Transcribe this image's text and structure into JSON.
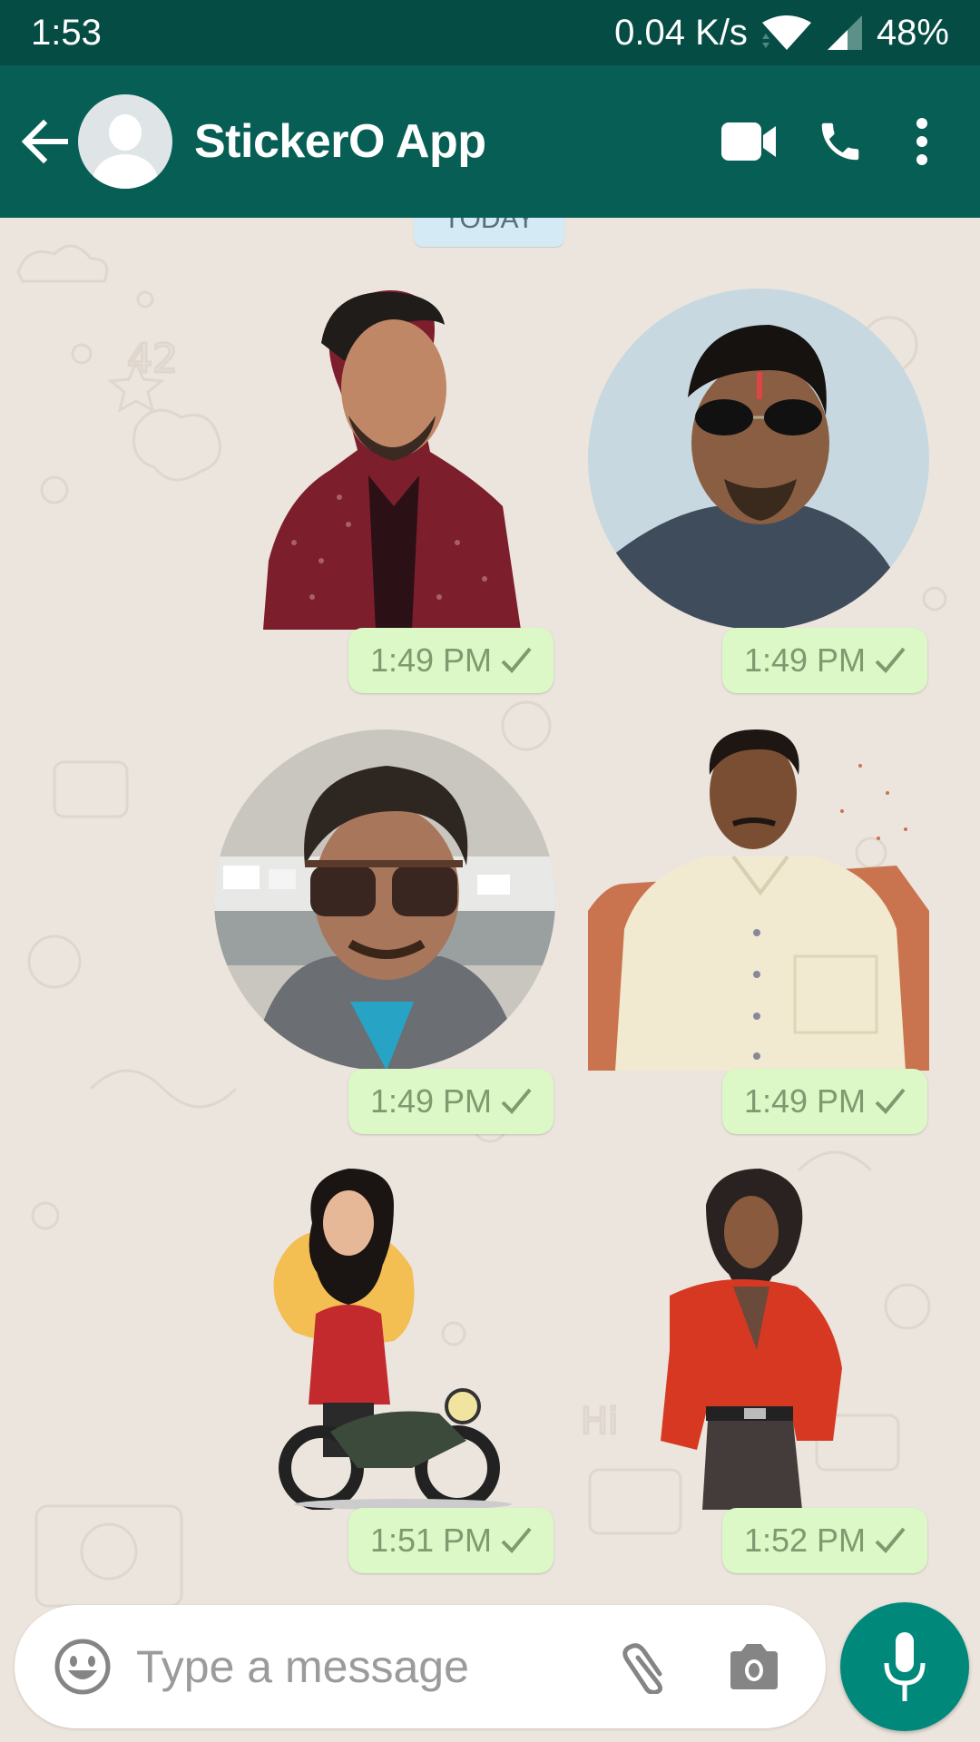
{
  "status_bar": {
    "time": "1:53",
    "network_speed": "0.04 K/s",
    "battery": "48%",
    "icons": [
      "wifi-icon",
      "cell-signal-icon"
    ]
  },
  "header": {
    "title": "StickerO App",
    "icons": [
      "back-arrow-icon",
      "avatar-icon",
      "video-call-icon",
      "voice-call-icon",
      "more-vert-icon"
    ]
  },
  "chat": {
    "date_label": "TODAY",
    "messages": [
      {
        "type": "sticker",
        "subject": "man in maroon shirt",
        "shape": "cutout",
        "time": "1:49 PM",
        "status": "sent"
      },
      {
        "type": "sticker",
        "subject": "man with aviator sunglasses",
        "shape": "circle",
        "time": "1:49 PM",
        "status": "sent"
      },
      {
        "type": "sticker",
        "subject": "man with sunglasses selfie",
        "shape": "circle",
        "time": "1:49 PM",
        "status": "sent"
      },
      {
        "type": "sticker",
        "subject": "man in cream kurta",
        "shape": "cutout",
        "time": "1:49 PM",
        "status": "sent"
      },
      {
        "type": "sticker",
        "subject": "cartoon bearded man with motorcycle",
        "shape": "cutout",
        "time": "1:51 PM",
        "status": "sent"
      },
      {
        "type": "sticker",
        "subject": "bearded man in red shirt",
        "shape": "cutout",
        "time": "1:52 PM",
        "status": "sent"
      }
    ]
  },
  "composer": {
    "placeholder": "Type a message",
    "value": "",
    "icons": [
      "emoji-icon",
      "attach-icon",
      "camera-icon",
      "mic-icon"
    ]
  },
  "colors": {
    "status_bar": "#054d44",
    "app_bar": "#075e54",
    "chat_bg": "#ece5dd",
    "bubble": "#dcf8c6",
    "timestamp": "#7d9a70",
    "date_chip": "#d4eaf4",
    "fab": "#00897b"
  }
}
